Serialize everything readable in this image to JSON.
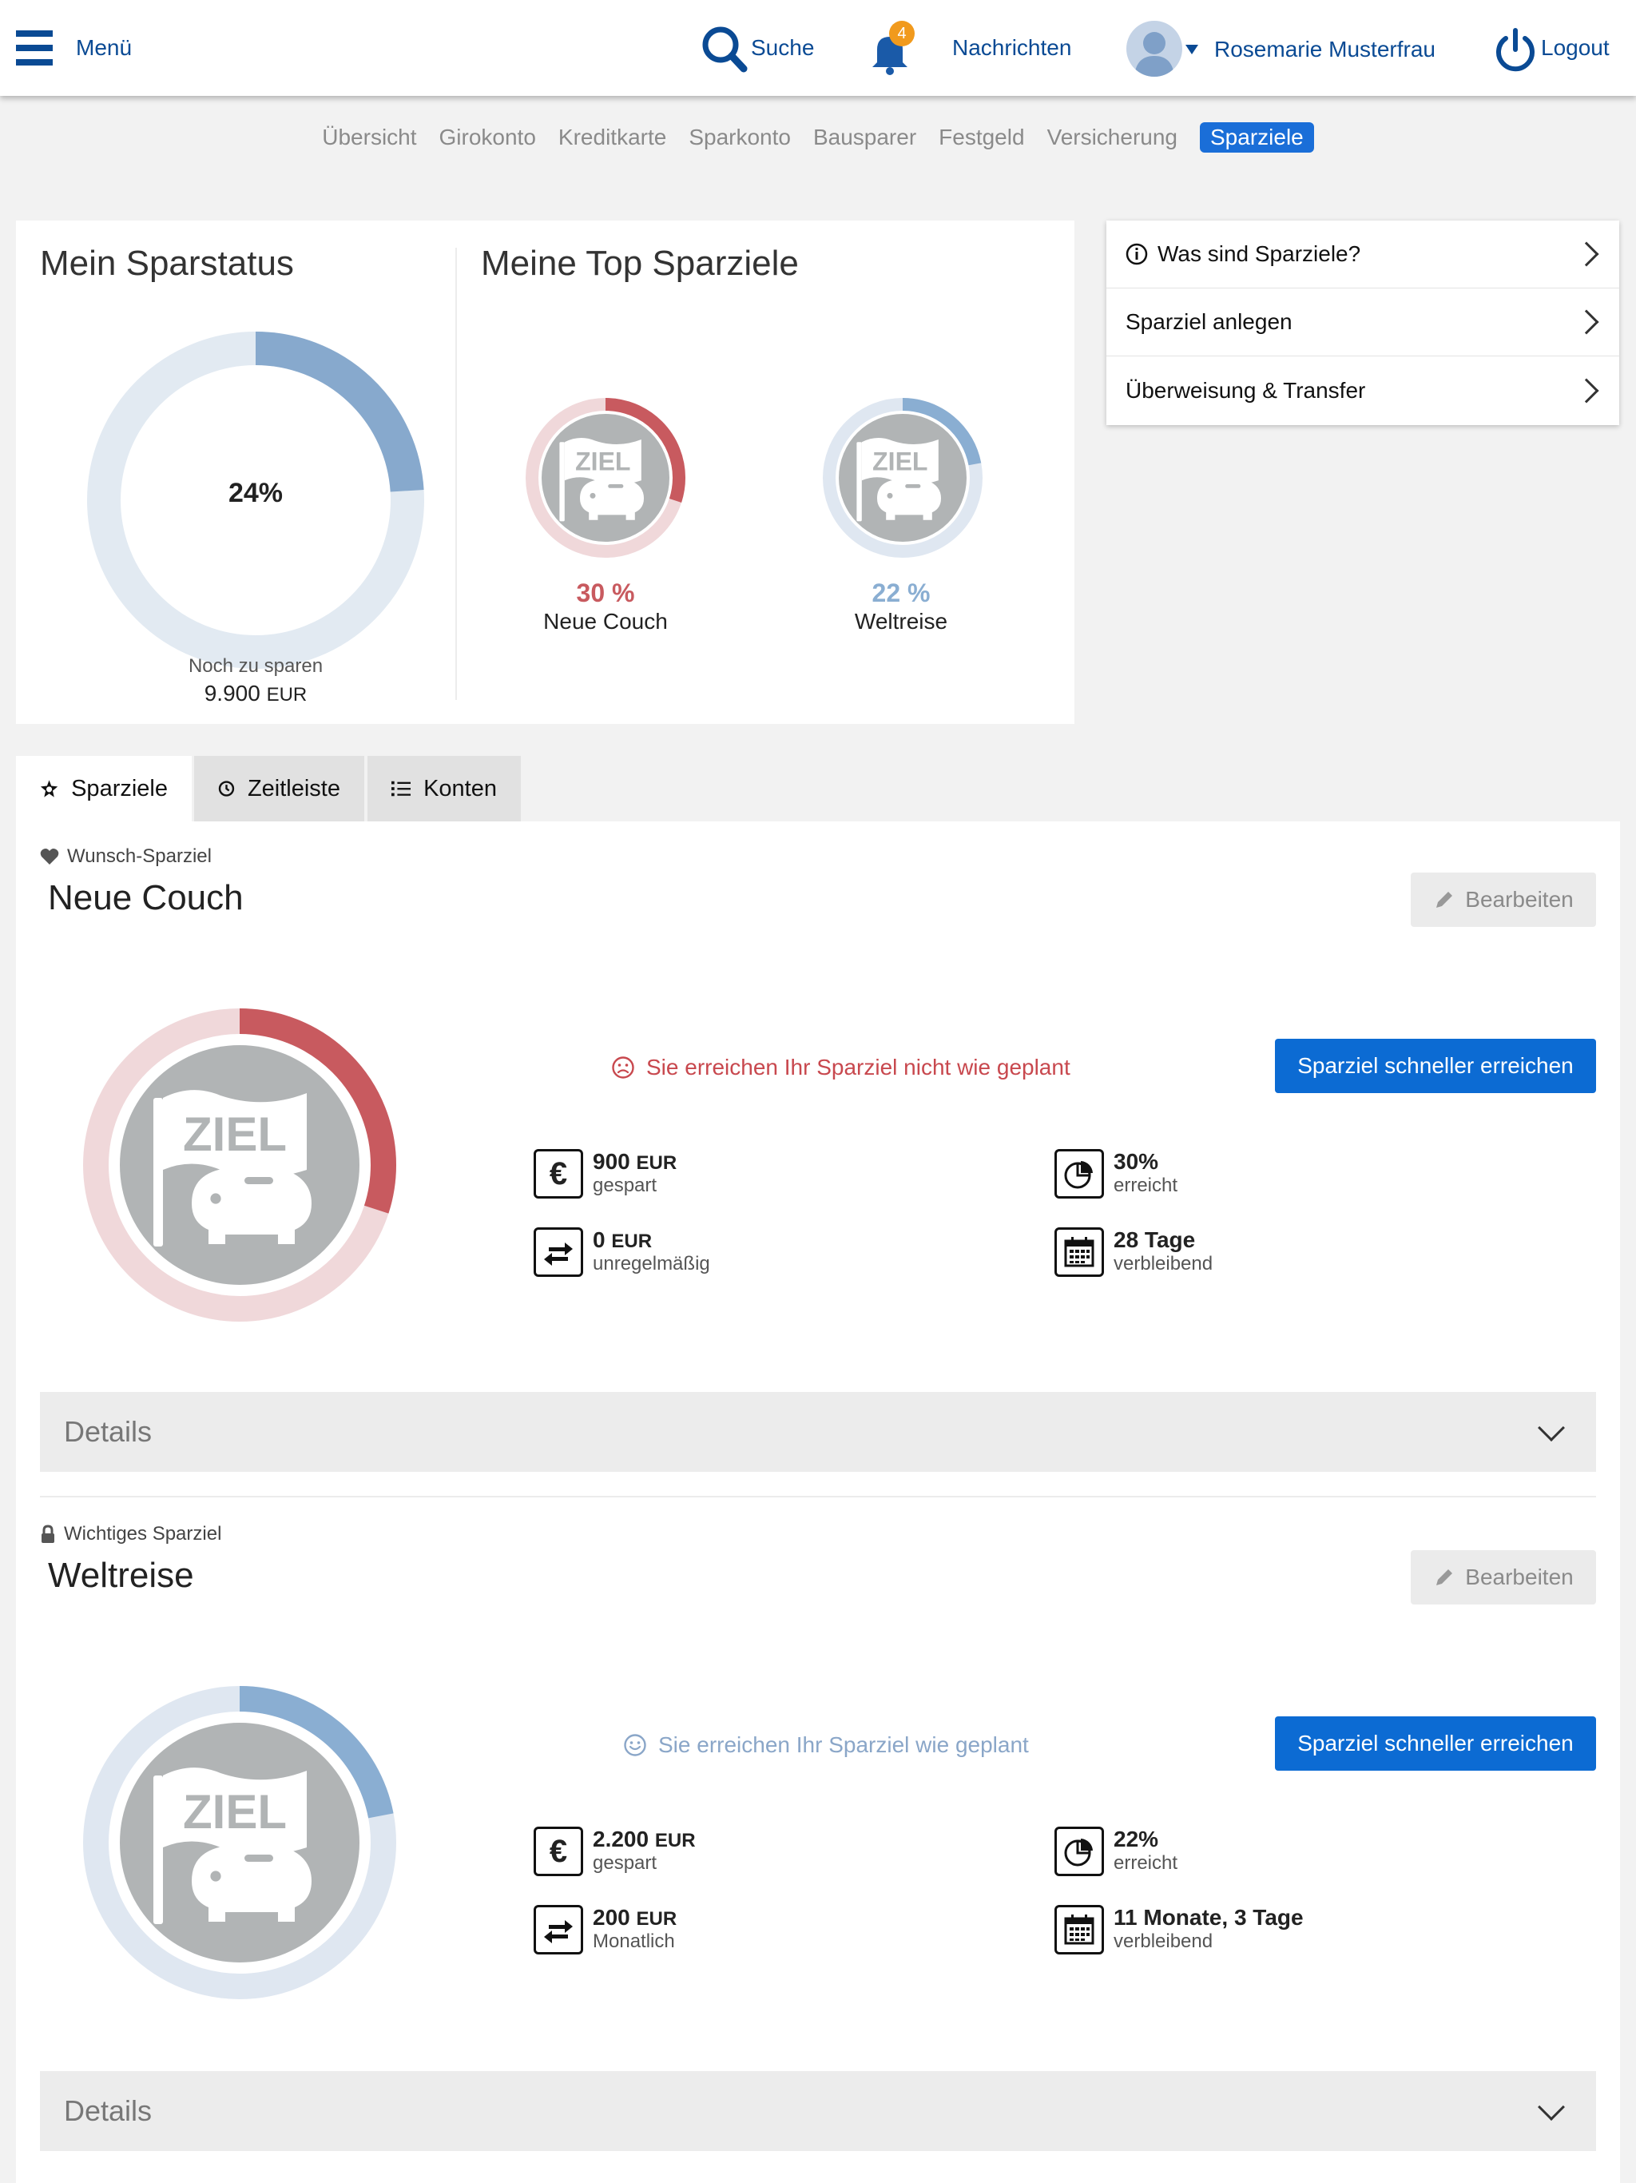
{
  "header": {
    "menu_label": "Menü",
    "search_label": "Suche",
    "notification_count": "4",
    "messages_label": "Nachrichten",
    "user_name": "Rosemarie Musterfrau",
    "logout_label": "Logout"
  },
  "subnav": {
    "items": [
      "Übersicht",
      "Girokonto",
      "Kreditkarte",
      "Sparkonto",
      "Bausparer",
      "Festgeld",
      "Versicherung",
      "Sparziele"
    ],
    "active": "Sparziele"
  },
  "status_card": {
    "title": "Mein Sparstatus",
    "percent": 24,
    "percent_label": "24%",
    "remaining_label": "Noch zu sparen",
    "remaining_value": "9.900",
    "remaining_unit": "EUR"
  },
  "top_goals": {
    "title": "Meine Top Sparziele",
    "goals": [
      {
        "name": "Neue Couch",
        "percent": 30,
        "percent_label": "30 %",
        "color": "#c85a5f",
        "track": "#f0d8da"
      },
      {
        "name": "Weltreise",
        "percent": 22,
        "percent_label": "22 %",
        "color": "#8aaed2",
        "track": "#dfe7f1"
      }
    ]
  },
  "side_menu": {
    "items": [
      "Was sind Sparziele?",
      "Sparziel anlegen",
      "Überweisung & Transfer"
    ]
  },
  "tabs": [
    "Sparziele",
    "Zeitleiste",
    "Konten"
  ],
  "goals": [
    {
      "category": "Wunsch-Sparziel",
      "title": "Neue Couch",
      "edit_label": "Bearbeiten",
      "status_text": "Sie erreichen Ihr Sparziel nicht wie geplant",
      "status_color": "#c8484e",
      "cta_label": "Sparziel schneller erreichen",
      "percent": 30,
      "ring_color": "#c85a5f",
      "ring_track": "#f0d8da",
      "saved_value": "900",
      "saved_unit": "EUR",
      "saved_label": "gespart",
      "reached_value": "30%",
      "reached_label": "erreicht",
      "rate_value": "0",
      "rate_unit": "EUR",
      "rate_label": "unregelmäßig",
      "remaining_value": "28 Tage",
      "remaining_label": "verbleibend",
      "details_label": "Details"
    },
    {
      "category": "Wichtiges Sparziel",
      "title": "Weltreise",
      "edit_label": "Bearbeiten",
      "status_text": "Sie erreichen Ihr Sparziel wie geplant",
      "status_color": "#8aa6c8",
      "cta_label": "Sparziel schneller erreichen",
      "percent": 22,
      "ring_color": "#8aaed2",
      "ring_track": "#dfe7f1",
      "saved_value": "2.200",
      "saved_unit": "EUR",
      "saved_label": "gespart",
      "reached_value": "22%",
      "reached_label": "erreicht",
      "rate_value": "200",
      "rate_unit": "EUR",
      "rate_label": "Monatlich",
      "remaining_value": "11 Monate, 3 Tage",
      "remaining_label": "verbleibend",
      "details_label": "Details"
    }
  ],
  "badge_text": "ZIEL",
  "colors": {
    "brand": "#0a4a94",
    "accent": "#1a6ed8",
    "cta": "#0c6bd3"
  }
}
